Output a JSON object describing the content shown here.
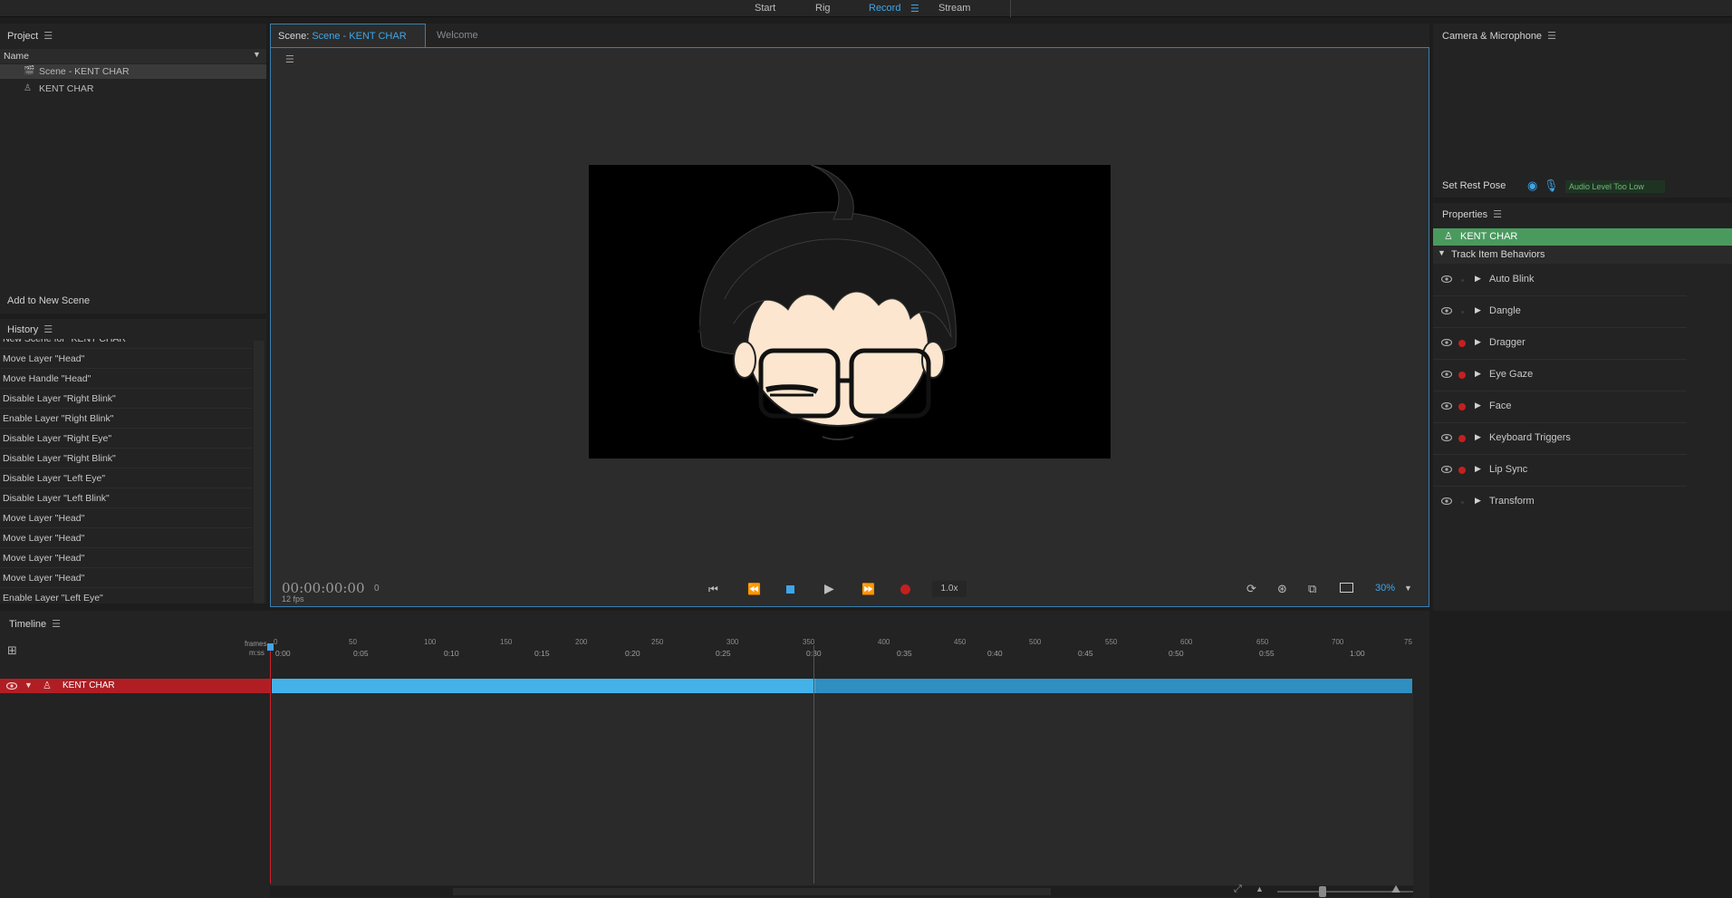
{
  "topbar": {
    "workspaces": [
      "Start",
      "Rig",
      "Record",
      "Stream"
    ],
    "active": "Record"
  },
  "project": {
    "title": "Project",
    "column_header": "Name",
    "items": [
      {
        "label": "Scene - KENT CHAR",
        "icon": "scene-icon",
        "selected": true
      },
      {
        "label": "KENT CHAR",
        "icon": "puppet-icon",
        "selected": false
      }
    ],
    "add_button": "Add to New Scene"
  },
  "history": {
    "title": "History",
    "items": [
      "New Scene for \"KENT CHAR\"",
      "Move Layer \"Head\"",
      "Move Handle \"Head\"",
      "Disable Layer \"Right Blink\"",
      "Enable Layer \"Right Blink\"",
      "Disable Layer \"Right Eye\"",
      "Disable Layer \"Right Blink\"",
      "Disable Layer \"Left Eye\"",
      "Disable Layer \"Left Blink\"",
      "Move Layer \"Head\"",
      "Move Layer \"Head\"",
      "Move Layer \"Head\"",
      "Move Layer \"Head\"",
      "Enable Layer \"Left Eye\""
    ]
  },
  "scene": {
    "tab_prefix": "Scene:",
    "tab_name": "Scene - KENT CHAR",
    "tab_welcome": "Welcome",
    "timecode": "00:00:00:00",
    "frame": "0",
    "fps": "12 fps",
    "speed": "1.0x",
    "zoom": "30%"
  },
  "camera": {
    "title": "Camera & Microphone",
    "rest_pose": "Set Rest Pose",
    "audio_status": "Audio Level Too Low"
  },
  "properties": {
    "title": "Properties",
    "puppet": "KENT CHAR",
    "section": "Track Item Behaviors",
    "behaviors": [
      {
        "label": "Auto Blink",
        "armed": false
      },
      {
        "label": "Dangle",
        "armed": false
      },
      {
        "label": "Dragger",
        "armed": true
      },
      {
        "label": "Eye Gaze",
        "armed": true
      },
      {
        "label": "Face",
        "armed": true
      },
      {
        "label": "Keyboard Triggers",
        "armed": true
      },
      {
        "label": "Lip Sync",
        "armed": true
      },
      {
        "label": "Transform",
        "armed": false
      }
    ]
  },
  "timeline": {
    "title": "Timeline",
    "row_frames_label": "frames",
    "row_time_label": "m:ss",
    "frame_ticks": [
      "0",
      "50",
      "100",
      "150",
      "200",
      "250",
      "300",
      "350",
      "400",
      "450",
      "500",
      "550",
      "600",
      "650",
      "700",
      "75"
    ],
    "time_ticks": [
      "0:00",
      "0:05",
      "0:10",
      "0:15",
      "0:20",
      "0:25",
      "0:30",
      "0:35",
      "0:40",
      "0:45",
      "0:50",
      "0:55",
      "1:00"
    ],
    "track_name": "KENT CHAR"
  },
  "colors": {
    "accent": "#3ea6e8",
    "record_red": "#c42020",
    "puppet_green": "#4a9a5e",
    "track_red": "#b01e24"
  }
}
